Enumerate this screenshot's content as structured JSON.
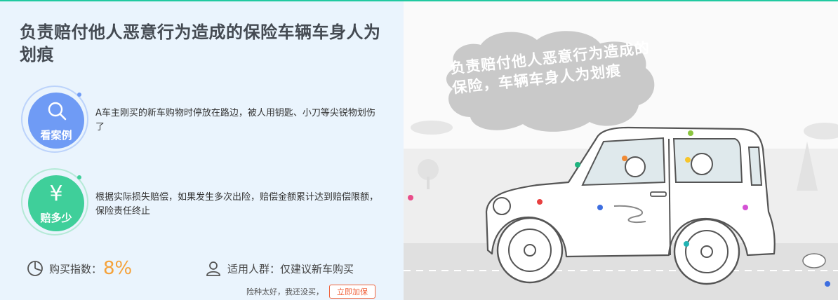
{
  "title": "负责赔付他人恶意行为造成的保险车辆车身人为划痕",
  "features": {
    "case": {
      "label": "看案例",
      "icon": "search-icon",
      "text": "A车主刚买的新车购物时停放在路边，被人用钥匙、小刀等尖锐物划伤了"
    },
    "pay": {
      "label": "赔多少",
      "icon": "yen-icon",
      "glyph": "¥",
      "text": "根据实际损失赔偿，如果发生多次出险，赔偿金额累计达到赔偿限额，保险责任终止"
    }
  },
  "stats": {
    "index_label": "购买指数：",
    "index_value": "8%",
    "crowd_label": "适用人群：",
    "crowd_value": "仅建议新车购买"
  },
  "footer": {
    "note": "险种太好，我还没买，",
    "button": "立即加保"
  },
  "illustration": {
    "bubble_text": "负责赔付他人恶意行为造成的保险，车辆车身人为划痕"
  },
  "colors": {
    "accent_blue": "#6f9bf5",
    "accent_green": "#3fcf9a",
    "orange": "#f5a23a",
    "button_red": "#f0623c"
  }
}
